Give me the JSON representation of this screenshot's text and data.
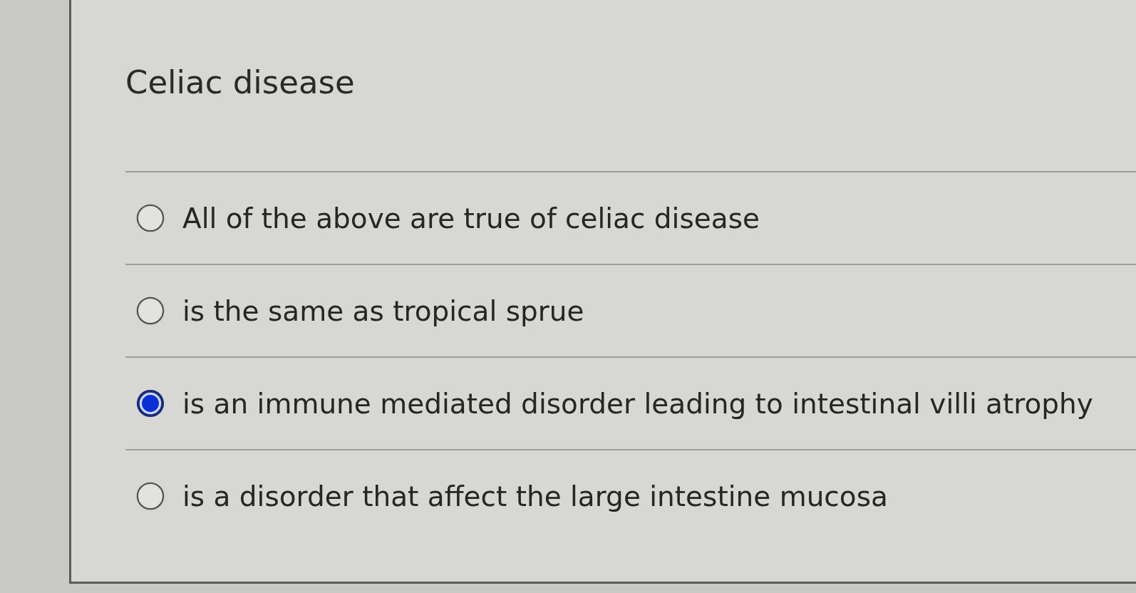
{
  "question": {
    "title": "Celiac disease"
  },
  "options": [
    {
      "label": "All of the above are true of celiac disease",
      "selected": false
    },
    {
      "label": "is the same as tropical sprue",
      "selected": false
    },
    {
      "label": "is an immune mediated disorder leading to intestinal villi atrophy",
      "selected": true
    },
    {
      "label": "is a disorder that affect the large intestine mucosa",
      "selected": false
    }
  ]
}
